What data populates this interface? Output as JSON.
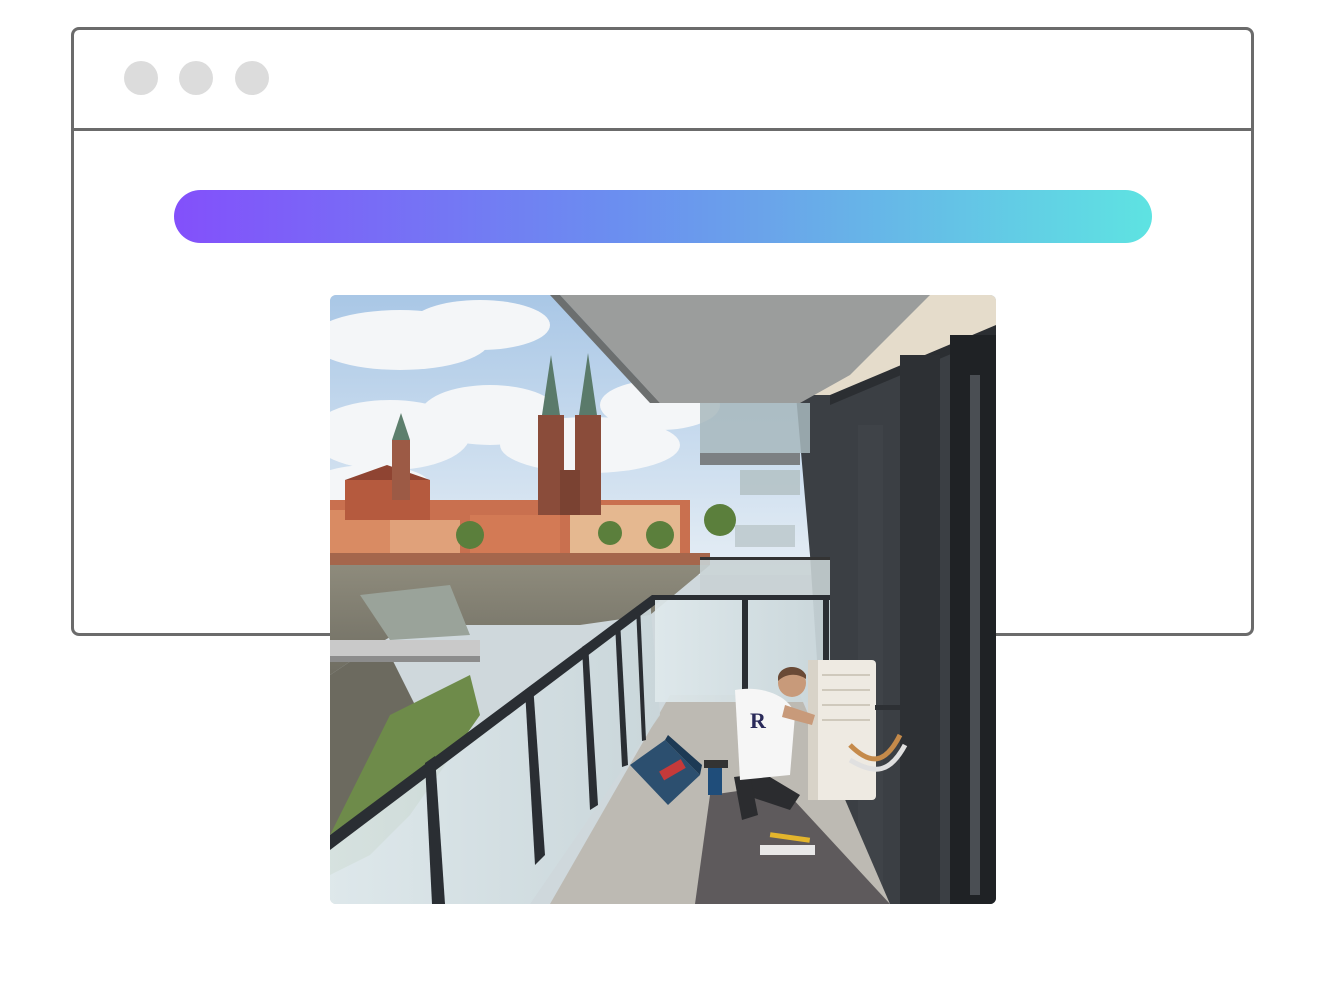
{
  "window": {
    "controls": [
      "window-dot",
      "window-dot",
      "window-dot"
    ],
    "control_color": "#dcdcdc",
    "frame_color": "#6b6b6b"
  },
  "banner": {
    "gradient_start": "#8350fb",
    "gradient_end": "#5ee3e2"
  },
  "photo": {
    "shirt_logo": "R"
  }
}
